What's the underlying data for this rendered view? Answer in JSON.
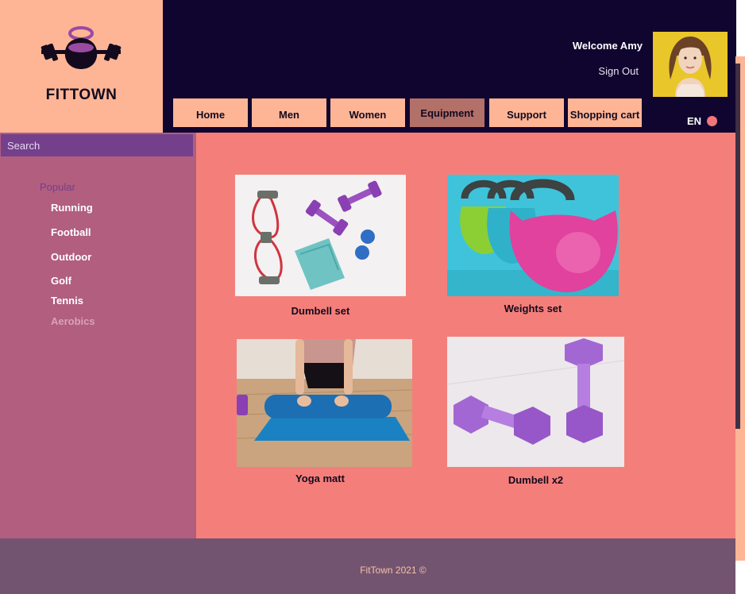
{
  "brand": {
    "name": "FITTOWN",
    "logo": "kettlebell-barbell-logo"
  },
  "header": {
    "welcome": "Welcome Amy",
    "sign_out": "Sign Out",
    "avatar": "user-avatar",
    "language": "EN"
  },
  "nav": {
    "items": [
      {
        "label": "Home"
      },
      {
        "label": "Men"
      },
      {
        "label": "Women"
      },
      {
        "label": "Equipment",
        "active": true
      },
      {
        "label": "Support"
      },
      {
        "label": "Shopping cart"
      }
    ]
  },
  "sidebar": {
    "search_placeholder": "Search",
    "heading": "Popular",
    "categories": [
      {
        "label": "Running"
      },
      {
        "label": "Football"
      },
      {
        "label": "Outdoor"
      },
      {
        "label": "Golf"
      },
      {
        "label": "Tennis"
      },
      {
        "label": "Aerobics",
        "muted": true
      }
    ]
  },
  "products": [
    {
      "name": "Dumbell set",
      "image": "dumbbell-set-photo"
    },
    {
      "name": "Weights set",
      "image": "kettlebell-weights-photo"
    },
    {
      "name": "Yoga matt",
      "image": "yoga-mat-photo"
    },
    {
      "name": "Dumbell x2",
      "image": "purple-dumbbells-photo"
    }
  ],
  "footer": {
    "text": "FitTown 2021 ©"
  },
  "colors": {
    "header_bg": "#10052f",
    "logo_panel": "#fdb596",
    "nav_button": "#fdb596",
    "nav_active": "#b27069",
    "sidebar_bg": "#b15e7f",
    "search_bg": "#74408c",
    "main_bg": "#f47f7a",
    "footer_bg": "#735470"
  }
}
